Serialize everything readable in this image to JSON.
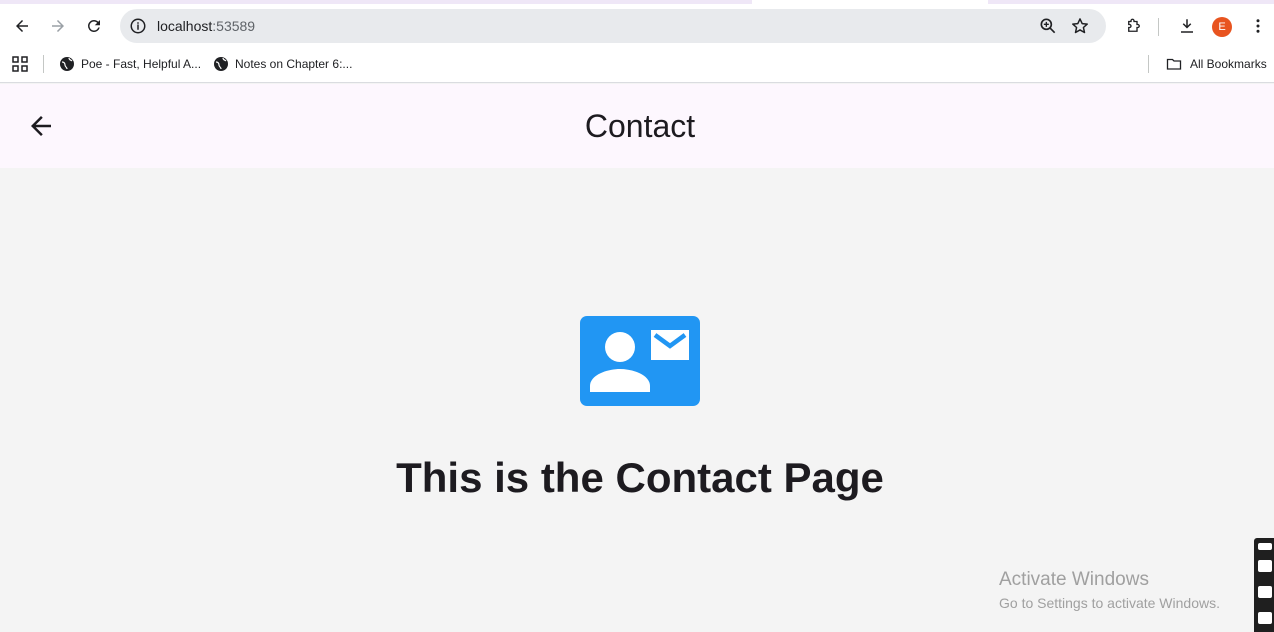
{
  "browser": {
    "url_host": "localhost",
    "url_port": ":53589",
    "profile_initial": "E",
    "bookmarks": [
      {
        "label": "Poe - Fast, Helpful A...",
        "icon": "globe-icon"
      },
      {
        "label": "Notes on Chapter 6:...",
        "icon": "globe-icon"
      }
    ],
    "all_bookmarks_label": "All Bookmarks"
  },
  "appbar": {
    "title": "Contact",
    "back_icon": "arrow-back-icon"
  },
  "page": {
    "icon": "contact-mail-icon",
    "heading": "This is the Contact Page"
  },
  "watermark": {
    "title": "Activate Windows",
    "subtitle": "Go to Settings to activate Windows."
  },
  "colors": {
    "accent": "#2196f3",
    "appbar_bg": "#fdf7fe",
    "body_bg": "#f4f4f4",
    "profile": "#e8541f"
  }
}
